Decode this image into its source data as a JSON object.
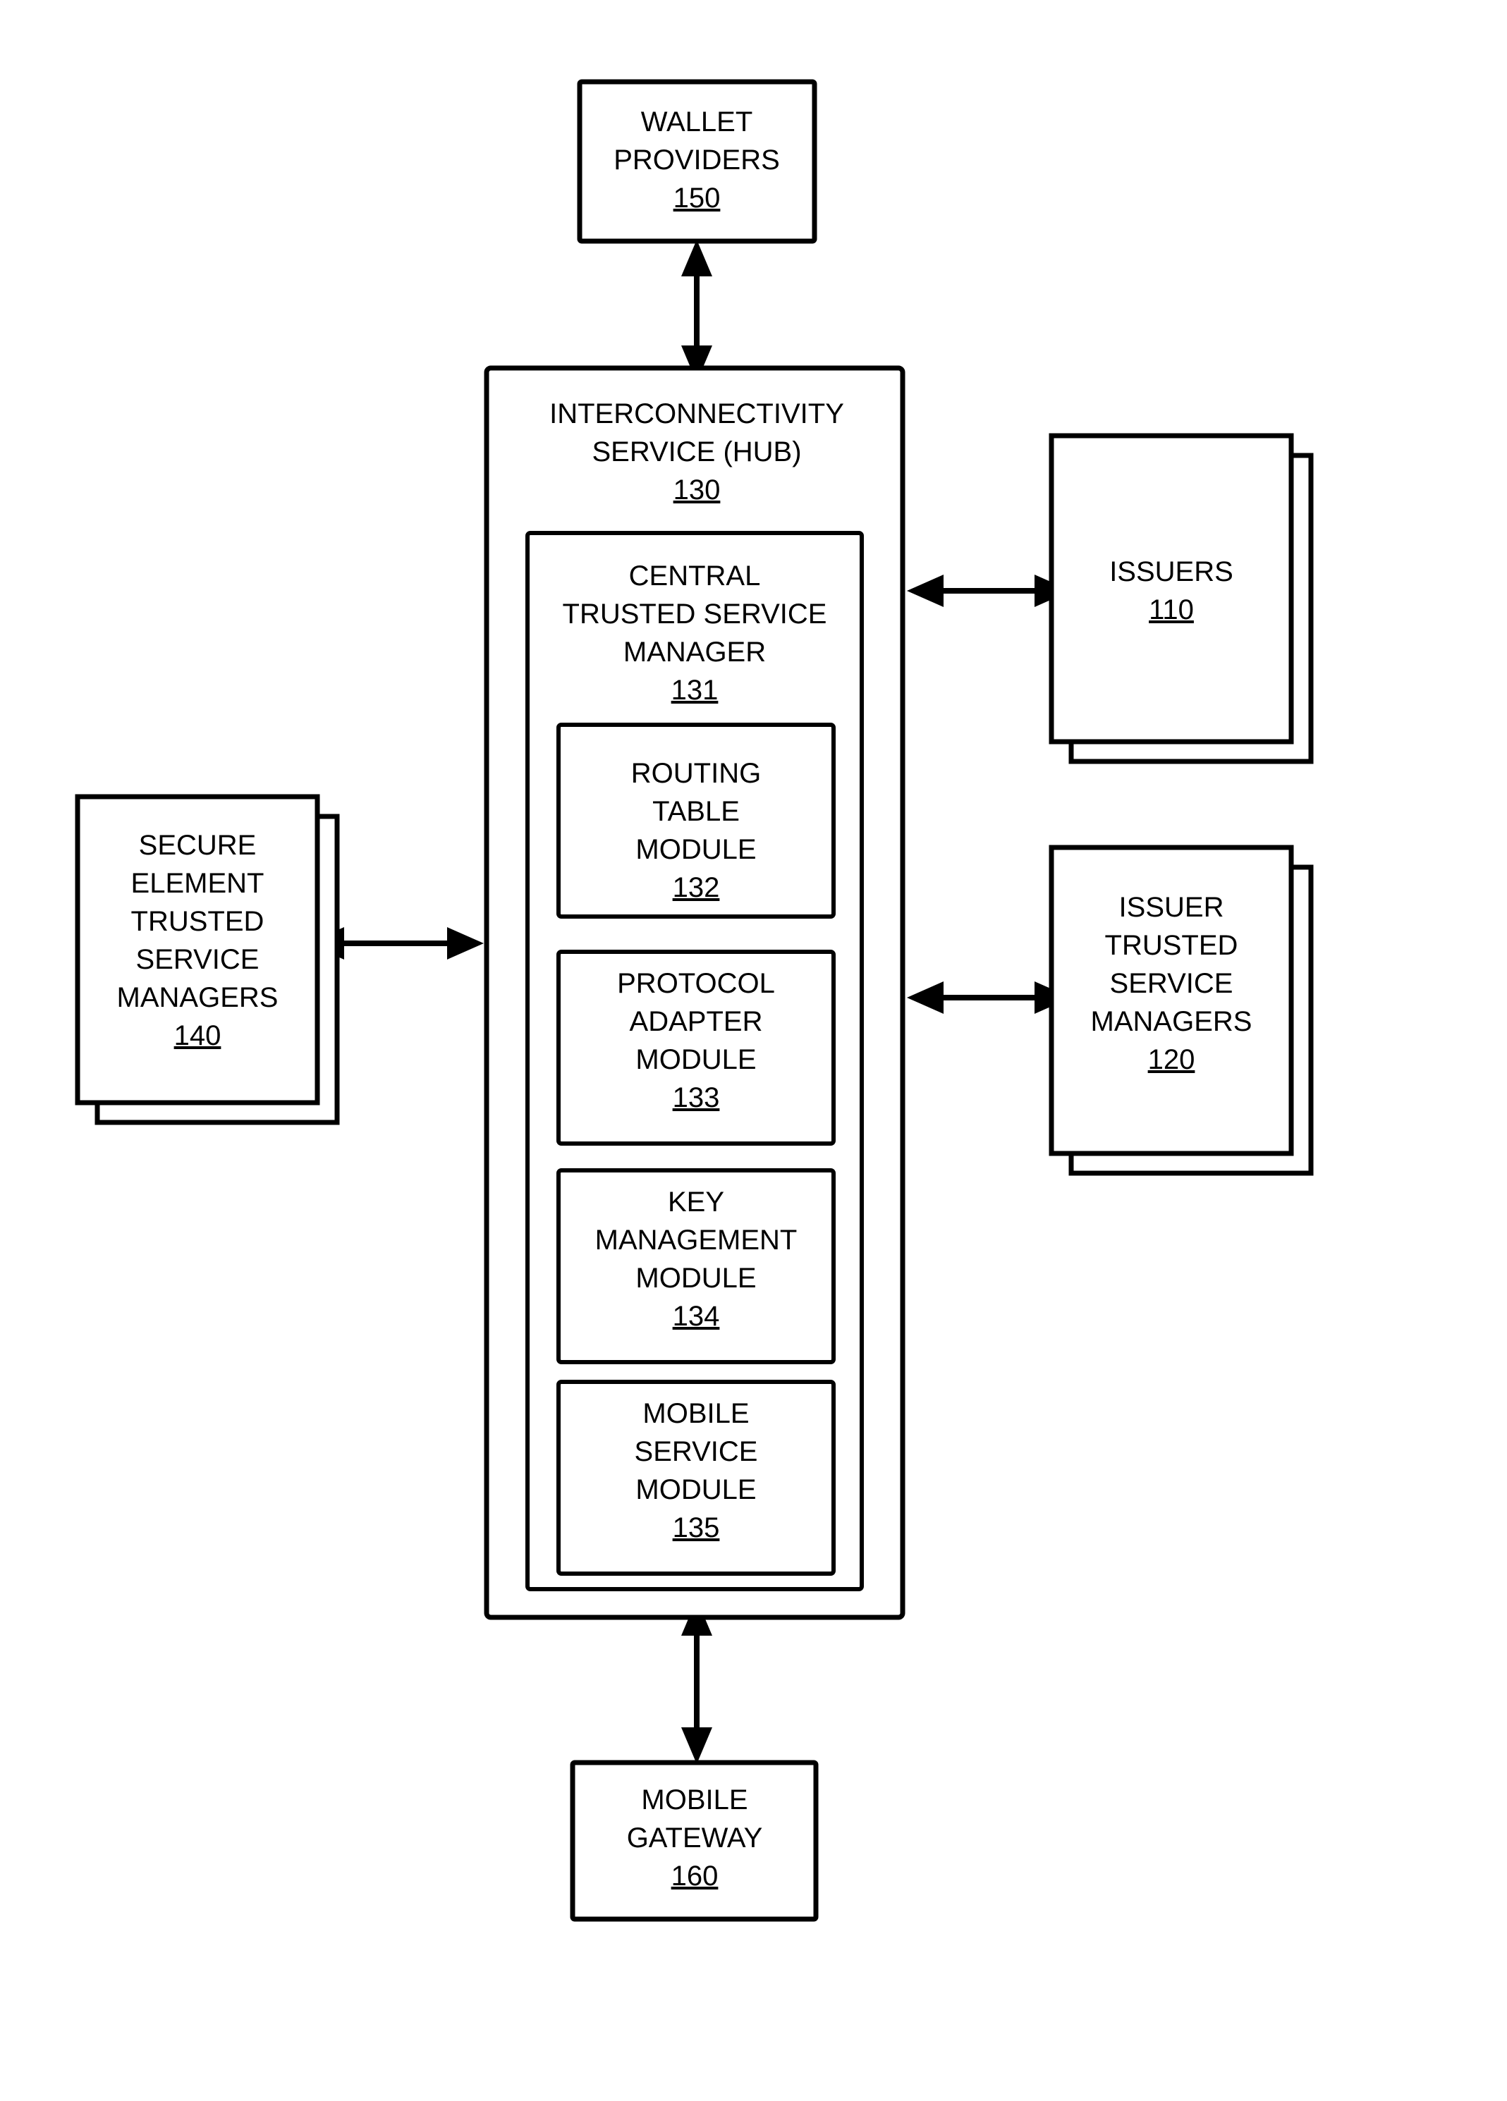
{
  "figure": {
    "title": "Interconnectivity service hub block diagram",
    "background_color": "#ffffff",
    "line_color": "#000000"
  },
  "nodes": {
    "wallet_providers": {
      "lines": [
        "WALLET",
        "PROVIDERS"
      ],
      "ref": "150",
      "stacked": false
    },
    "hub": {
      "lines": [
        "INTERCONNECTIVITY",
        "SERVICE (HUB)"
      ],
      "ref": "130",
      "stacked": false
    },
    "central_tsm": {
      "lines": [
        "CENTRAL",
        "TRUSTED SERVICE",
        "MANAGER"
      ],
      "ref": "131",
      "stacked": false
    },
    "routing_table_module": {
      "lines": [
        "ROUTING",
        "TABLE",
        "MODULE"
      ],
      "ref": "132",
      "stacked": false
    },
    "protocol_adapter_module": {
      "lines": [
        "PROTOCOL",
        "ADAPTER",
        "MODULE"
      ],
      "ref": "133",
      "stacked": false
    },
    "key_management_module": {
      "lines": [
        "KEY",
        "MANAGEMENT",
        "MODULE"
      ],
      "ref": "134",
      "stacked": false
    },
    "mobile_service_module": {
      "lines": [
        "MOBILE",
        "SERVICE",
        "MODULE"
      ],
      "ref": "135",
      "stacked": false
    },
    "issuers": {
      "lines": [
        "ISSUERS"
      ],
      "ref": "110",
      "stacked": true
    },
    "issuer_tsm": {
      "lines": [
        "ISSUER",
        "TRUSTED",
        "SERVICE",
        "MANAGERS"
      ],
      "ref": "120",
      "stacked": true
    },
    "secure_element_tsm": {
      "lines": [
        "SECURE",
        "ELEMENT",
        "TRUSTED",
        "SERVICE",
        "MANAGERS"
      ],
      "ref": "140",
      "stacked": true
    },
    "mobile_gateway": {
      "lines": [
        "MOBILE",
        "GATEWAY"
      ],
      "ref": "160",
      "stacked": false
    }
  },
  "connectors": [
    {
      "id": "wallet-hub",
      "from": "wallet_providers",
      "to": "hub",
      "direction": "bidirectional",
      "orientation": "vertical"
    },
    {
      "id": "hub-issuers",
      "from": "hub",
      "to": "issuers",
      "direction": "bidirectional",
      "orientation": "horizontal"
    },
    {
      "id": "hub-issuer-tsm",
      "from": "hub",
      "to": "issuer_tsm",
      "direction": "bidirectional",
      "orientation": "horizontal"
    },
    {
      "id": "setsm-hub",
      "from": "secure_element_tsm",
      "to": "hub",
      "direction": "bidirectional",
      "orientation": "horizontal"
    },
    {
      "id": "hub-mobile-gateway",
      "from": "hub",
      "to": "mobile_gateway",
      "direction": "bidirectional",
      "orientation": "vertical"
    }
  ]
}
